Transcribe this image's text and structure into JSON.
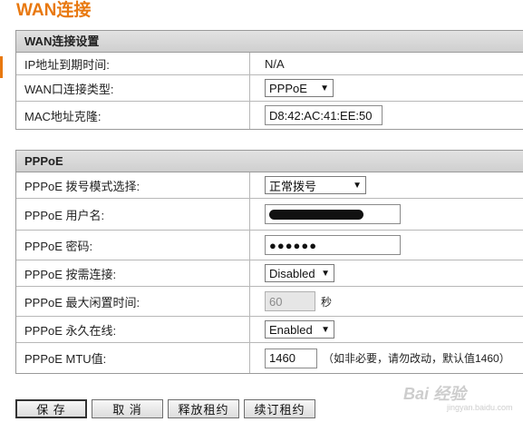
{
  "page": {
    "title": "WAN连接"
  },
  "wan_settings": {
    "header": "WAN连接设置",
    "ip_expire": {
      "label": "IP地址到期时间:",
      "value": "N/A"
    },
    "wan_type": {
      "label": "WAN口连接类型:",
      "selected": "PPPoE"
    },
    "mac_clone": {
      "label": "MAC地址克隆:",
      "value": "D8:42:AC:41:EE:50"
    }
  },
  "pppoe": {
    "header": "PPPoE",
    "dial_mode": {
      "label": "PPPoE 拨号模式选择:",
      "selected": "正常拨号"
    },
    "username": {
      "label": "PPPoE 用户名:"
    },
    "password": {
      "label": "PPPoE 密码:",
      "value": "●●●●●●"
    },
    "on_demand": {
      "label": "PPPoE 按需连接:",
      "selected": "Disabled"
    },
    "max_idle": {
      "label": "PPPoE 最大闲置时间:",
      "value": "60",
      "unit": "秒"
    },
    "always_on": {
      "label": "PPPoE 永久在线:",
      "selected": "Enabled"
    },
    "mtu": {
      "label": "PPPoE MTU值:",
      "value": "1460",
      "hint": "（如非必要，请勿改动，默认值1460）"
    }
  },
  "buttons": {
    "save": "保 存",
    "cancel": "取 消",
    "release": "释放租约",
    "renew": "续订租约"
  },
  "watermark": {
    "main": "Bai 经验",
    "sub": "jingyan.baidu.com"
  },
  "colors": {
    "accent": "#e8780f",
    "header_bg": "#d8d8d8"
  }
}
